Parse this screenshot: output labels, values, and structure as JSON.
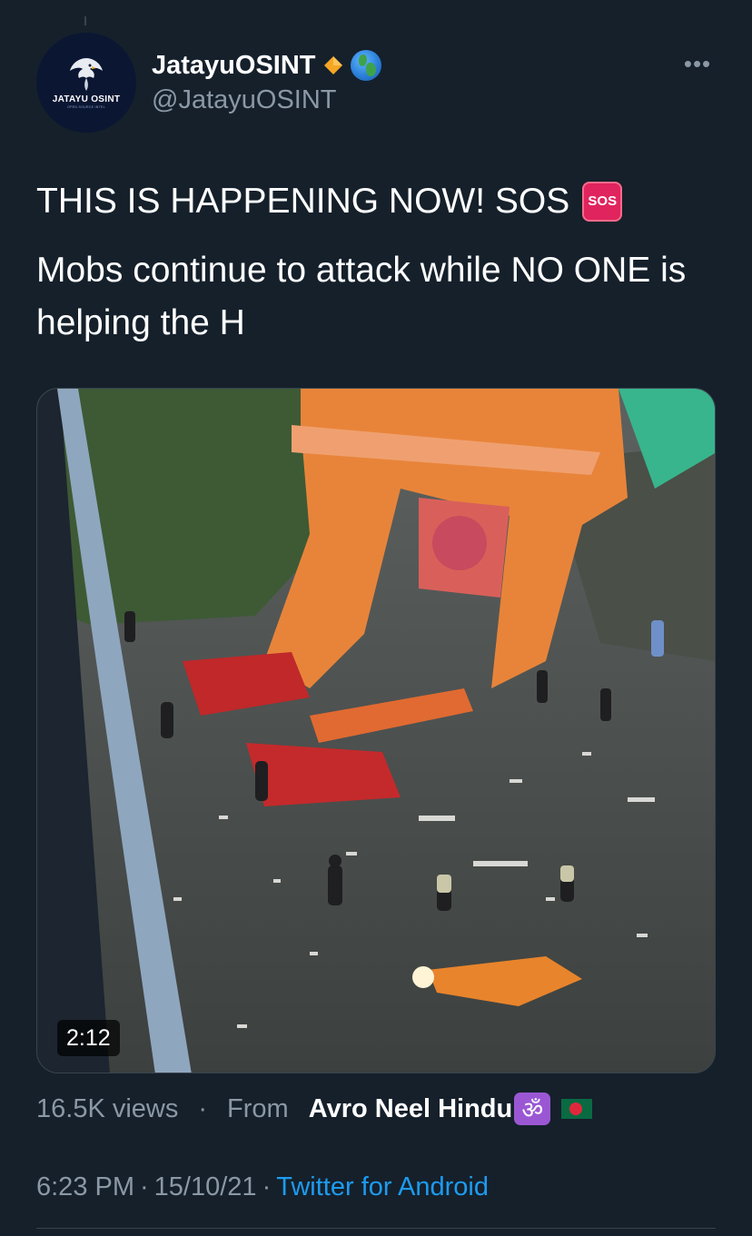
{
  "tweet": {
    "author": {
      "display_name": "JatayuOSINT",
      "handle": "@JatayuOSINT",
      "avatar_brand": "JATAYU OSINT",
      "avatar_subtitle": "OPEN SOURCE INTEL",
      "badges": [
        "diamond-icon",
        "globe-icon"
      ]
    },
    "more_label": "•••",
    "text": {
      "line1": "THIS IS HAPPENING NOW! SOS",
      "sos_emoji": "SOS",
      "line2": "Mobs continue to attack while NO ONE is helping the H"
    },
    "media": {
      "type": "video",
      "duration": "2:12"
    },
    "views": "16.5K views",
    "separator": "·",
    "from_label": "From",
    "source_name": "Avro Neel Hindu",
    "source_emojis": [
      "om-icon",
      "flag-bangladesh-icon"
    ],
    "om_glyph": "ॐ",
    "time": "6:23 PM",
    "date": "15/10/21",
    "client": "Twitter for Android"
  },
  "colors": {
    "background": "#15202b",
    "text_primary": "#ffffff",
    "text_secondary": "#8b98a5",
    "link": "#1d9bf0"
  }
}
